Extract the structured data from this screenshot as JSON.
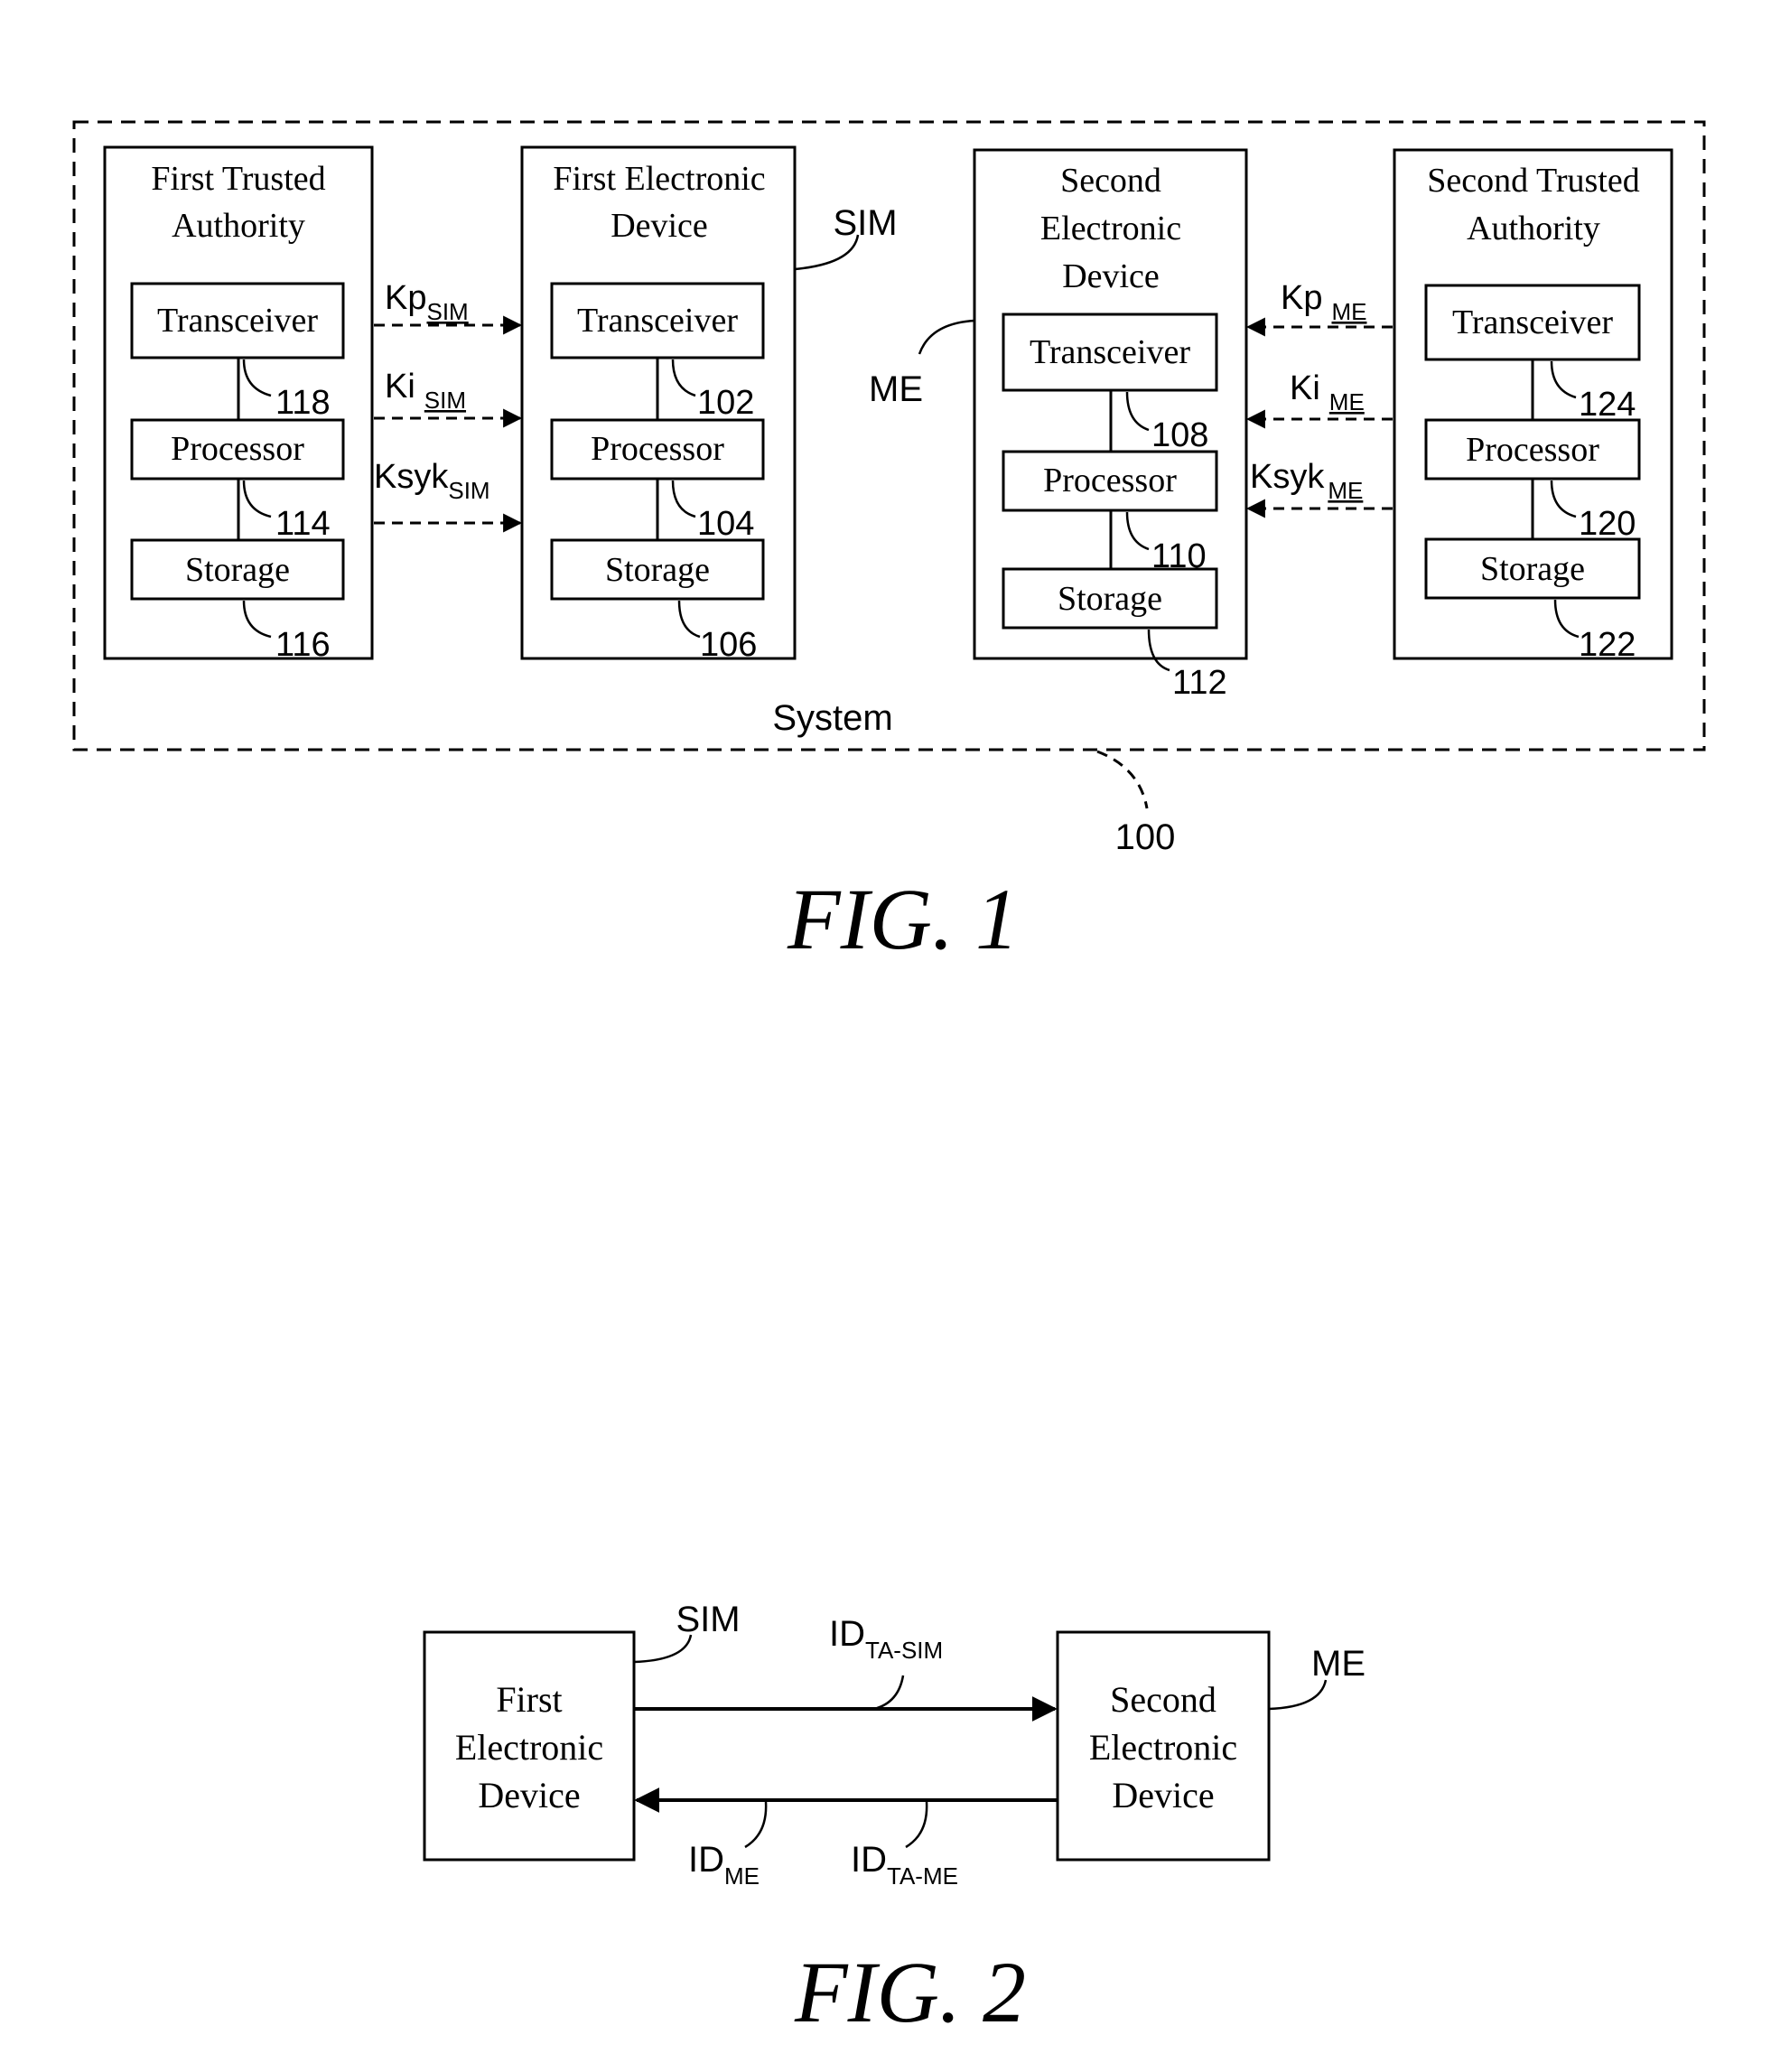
{
  "figure1": {
    "caption": "FIG. 1",
    "system_label": "System",
    "system_ref": "100",
    "blocks": [
      {
        "title_lines": [
          "First Trusted",
          "Authority"
        ],
        "components": [
          {
            "label": "Transceiver",
            "ref": "118"
          },
          {
            "label": "Processor",
            "ref": "114"
          },
          {
            "label": "Storage",
            "ref": "116"
          }
        ]
      },
      {
        "title_lines": [
          "First Electronic",
          "Device"
        ],
        "tag": "SIM",
        "components": [
          {
            "label": "Transceiver",
            "ref": "102"
          },
          {
            "label": "Processor",
            "ref": "104"
          },
          {
            "label": "Storage",
            "ref": "106"
          }
        ]
      },
      {
        "title_lines": [
          "Second",
          "Electronic",
          "Device"
        ],
        "tag": "ME",
        "components": [
          {
            "label": "Transceiver",
            "ref": "108"
          },
          {
            "label": "Processor",
            "ref": "110"
          },
          {
            "label": "Storage",
            "ref": "112"
          }
        ]
      },
      {
        "title_lines": [
          "Second Trusted",
          "Authority"
        ],
        "components": [
          {
            "label": "Transceiver",
            "ref": "124"
          },
          {
            "label": "Processor",
            "ref": "120"
          },
          {
            "label": "Storage",
            "ref": "122"
          }
        ]
      }
    ],
    "left_arrows": [
      {
        "base": "Kp",
        "sub": "SIM"
      },
      {
        "base": "Ki",
        "sub": "SIM"
      },
      {
        "base": "Ksyk",
        "sub": "SIM"
      }
    ],
    "right_arrows": [
      {
        "base": "Kp",
        "sub": "ME"
      },
      {
        "base": "Ki",
        "sub": "ME"
      },
      {
        "base": "Ksyk",
        "sub": "ME"
      }
    ]
  },
  "figure2": {
    "caption": "FIG. 2",
    "left_block": {
      "title_lines": [
        "First",
        "Electronic",
        "Device"
      ],
      "tag": "SIM"
    },
    "right_block": {
      "title_lines": [
        "Second",
        "Electronic",
        "Device"
      ],
      "tag": "ME"
    },
    "top_arrow_label": {
      "base": "ID",
      "sub": "TA-SIM"
    },
    "bottom_arrow_labels": [
      {
        "base": "ID",
        "sub": "ME"
      },
      {
        "base": "ID",
        "sub": "TA-ME"
      }
    ]
  }
}
